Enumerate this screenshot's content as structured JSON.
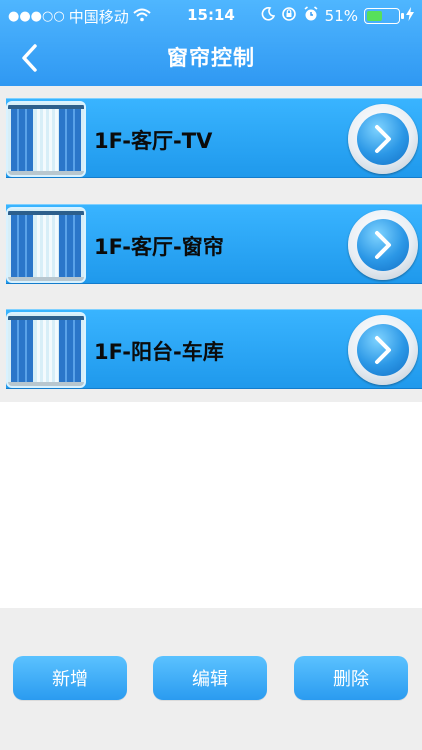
{
  "status_bar": {
    "signal": "●●●○○",
    "carrier": "中国移动",
    "time": "15:14",
    "battery_percent": "51%",
    "battery_level": 0.51
  },
  "nav": {
    "title": "窗帘控制"
  },
  "items": [
    {
      "label": "1F-客厅-TV"
    },
    {
      "label": "1F-客厅-窗帘"
    },
    {
      "label": "1F-阳台-车库"
    }
  ],
  "actions": {
    "add_label": "新增",
    "edit_label": "编辑",
    "delete_label": "删除"
  },
  "colors": {
    "accent": "#2f98f2",
    "row_blue": "#1f99ec",
    "background_gray": "#eeeeee"
  }
}
